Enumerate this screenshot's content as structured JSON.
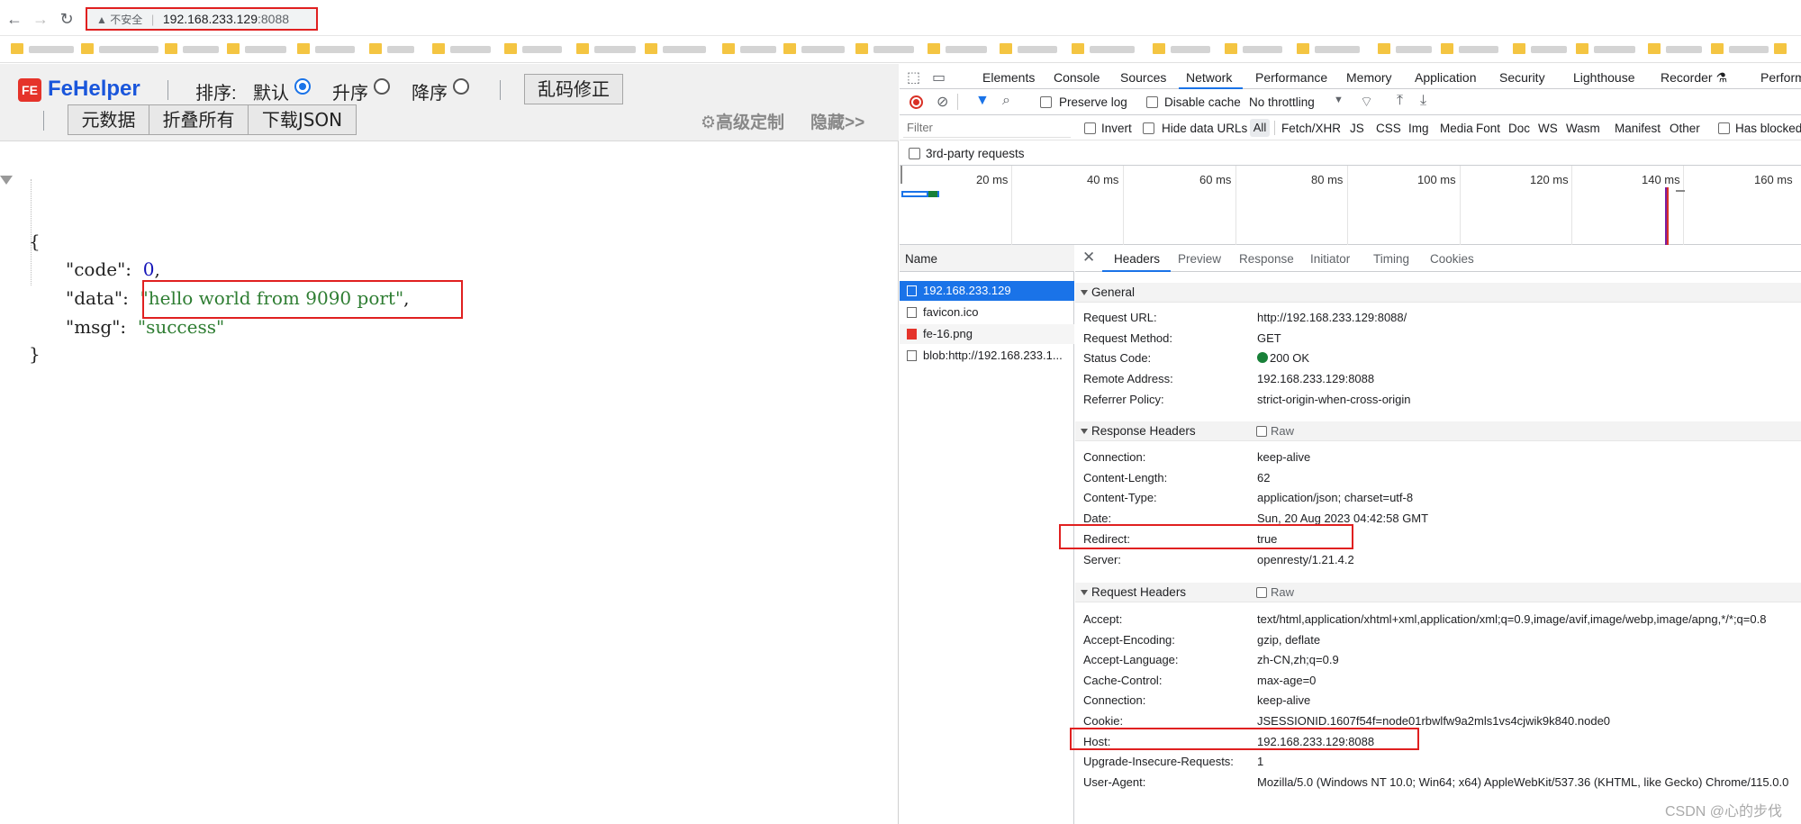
{
  "browser": {
    "address": {
      "security_label": "不安全",
      "host": "192.168.233.129",
      "port": ":8088"
    },
    "nav": {
      "back": "←",
      "forward": "→",
      "reload": "↻"
    }
  },
  "fehelper": {
    "logo": "FE",
    "title": "FeHelper",
    "sort_label": "排序:",
    "sort_default": "默认",
    "sort_asc": "升序",
    "sort_desc": "降序",
    "fix_encoding": "乱码修正",
    "raw_data": "元数据",
    "fold_all": "折叠所有",
    "download_json": "下载JSON",
    "advanced": "⚙高级定制",
    "hide": "隐藏>>"
  },
  "json": {
    "open_brace": "{",
    "close_brace": "}",
    "lines": [
      {
        "key": "\"code\":",
        "value": "0",
        "suffix": ","
      },
      {
        "key": "\"data\":",
        "value": "\"hello world from 9090 port\"",
        "suffix": ","
      },
      {
        "key": "\"msg\":",
        "value": "\"success\"",
        "suffix": ""
      }
    ]
  },
  "devtools": {
    "tabs": [
      "Elements",
      "Console",
      "Sources",
      "Network",
      "Performance",
      "Memory",
      "Application",
      "Security",
      "Lighthouse",
      "Recorder ⚗",
      "Perform"
    ],
    "active_tab": "Network",
    "toolbar": {
      "preserve_log": "Preserve log",
      "disable_cache": "Disable cache",
      "throttling": "No throttling"
    },
    "filter": {
      "placeholder": "Filter",
      "invert": "Invert",
      "hide_data_urls": "Hide data URLs",
      "types": [
        "All",
        "Fetch/XHR",
        "JS",
        "CSS",
        "Img",
        "Media",
        "Font",
        "Doc",
        "WS",
        "Wasm",
        "Manifest",
        "Other"
      ],
      "has_blocked": "Has blocked",
      "third_party": "3rd-party requests"
    },
    "timeline_ticks": [
      "20 ms",
      "40 ms",
      "60 ms",
      "80 ms",
      "100 ms",
      "120 ms",
      "140 ms",
      "160 ms"
    ],
    "name_header": "Name",
    "requests": [
      "192.168.233.129",
      "favicon.ico",
      "fe-16.png",
      "blob:http://192.168.233.1..."
    ],
    "detail_tabs": [
      "Headers",
      "Preview",
      "Response",
      "Initiator",
      "Timing",
      "Cookies"
    ],
    "general": {
      "title": "General",
      "rows": [
        {
          "k": "Request URL:",
          "v": "http://192.168.233.129:8088/"
        },
        {
          "k": "Request Method:",
          "v": "GET"
        },
        {
          "k": "Status Code:",
          "v": "200 OK"
        },
        {
          "k": "Remote Address:",
          "v": "192.168.233.129:8088"
        },
        {
          "k": "Referrer Policy:",
          "v": "strict-origin-when-cross-origin"
        }
      ]
    },
    "response_headers": {
      "title": "Response Headers",
      "raw": "Raw",
      "rows": [
        {
          "k": "Connection:",
          "v": "keep-alive"
        },
        {
          "k": "Content-Length:",
          "v": "62"
        },
        {
          "k": "Content-Type:",
          "v": "application/json; charset=utf-8"
        },
        {
          "k": "Date:",
          "v": "Sun, 20 Aug 2023 04:42:58 GMT"
        },
        {
          "k": "Redirect:",
          "v": "true"
        },
        {
          "k": "Server:",
          "v": "openresty/1.21.4.2"
        }
      ]
    },
    "request_headers": {
      "title": "Request Headers",
      "raw": "Raw",
      "rows": [
        {
          "k": "Accept:",
          "v": "text/html,application/xhtml+xml,application/xml;q=0.9,image/avif,image/webp,image/apng,*/*;q=0.8"
        },
        {
          "k": "Accept-Encoding:",
          "v": "gzip, deflate"
        },
        {
          "k": "Accept-Language:",
          "v": "zh-CN,zh;q=0.9"
        },
        {
          "k": "Cache-Control:",
          "v": "max-age=0"
        },
        {
          "k": "Connection:",
          "v": "keep-alive"
        },
        {
          "k": "Cookie:",
          "v": "JSESSIONID.1607f54f=node01rbwlfw9a2mls1vs4cjwik9k840.node0"
        },
        {
          "k": "Host:",
          "v": "192.168.233.129:8088"
        },
        {
          "k": "Upgrade-Insecure-Requests:",
          "v": "1"
        },
        {
          "k": "User-Agent:",
          "v": "Mozilla/5.0 (Windows NT 10.0; Win64; x64) AppleWebKit/537.36 (KHTML, like Gecko) Chrome/115.0.0"
        }
      ]
    }
  },
  "watermark": "CSDN @心的步伐",
  "colors": {
    "highlight": "#e02020",
    "accent": "#1a73e8",
    "json_string": "#2e7d32",
    "json_number": "#1414b8"
  }
}
